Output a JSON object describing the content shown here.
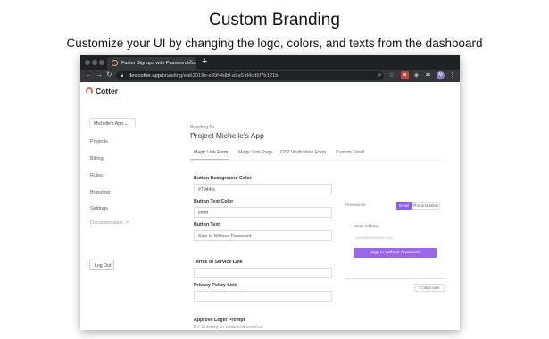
{
  "hero": {
    "title": "Custom Branding",
    "subtitle": "Customize your UI by changing the logo, colors, and texts from the dashboard"
  },
  "browser": {
    "tab_title": "Faster Signups with Passwordless",
    "tab_close": "×",
    "new_tab": "+",
    "back": "←",
    "forward": "→",
    "reload": "↻",
    "url_host": "dev.cotter.app",
    "url_path": "/branding/eab3019e-e39f-4dbf-a9a5-d4cd6f7b121b",
    "lock_icon": "lock-icon",
    "profile_initial": "M"
  },
  "app": {
    "logo_text": "Cotter",
    "brand_color": "#e06a5c",
    "accent_color": "#8b5cf6"
  },
  "sidebar": {
    "app_selector": "Michelle's App ⌄",
    "items": [
      "Projects",
      "Billing",
      "Rules",
      "Branding",
      "Settings",
      "Documentation ↗"
    ],
    "logout": "Log Out"
  },
  "main": {
    "branding_for": "Branding for",
    "project_title": "Project Michelle's App",
    "tabs": [
      "Magic Link Form",
      "Magic Link Page",
      "OTP Verification Form",
      "Custom Email"
    ],
    "fields": {
      "bg_color_label": "Button Background Color",
      "bg_color_value": "#7d44fa",
      "text_color_label": "Button Text Color",
      "text_color_value": "#ffffff",
      "button_text_label": "Button Text",
      "button_text_value": "Sign In Without Password",
      "tos_label": "Terms of Service Link",
      "tos_value": "",
      "privacy_label": "Privacy Policy Link",
      "privacy_value": "",
      "approve_label": "Approve Login Prompt",
      "approve_hint": "Ex: Entering an email and continue"
    }
  },
  "preview": {
    "label": "Preview for",
    "email_tab": "Email",
    "phone_tab": "Phone Number",
    "email_label": "Email Address",
    "email_placeholder": "email@example.com",
    "signin_button": "Sign In Without Password",
    "start_over": "↻ Start over"
  }
}
